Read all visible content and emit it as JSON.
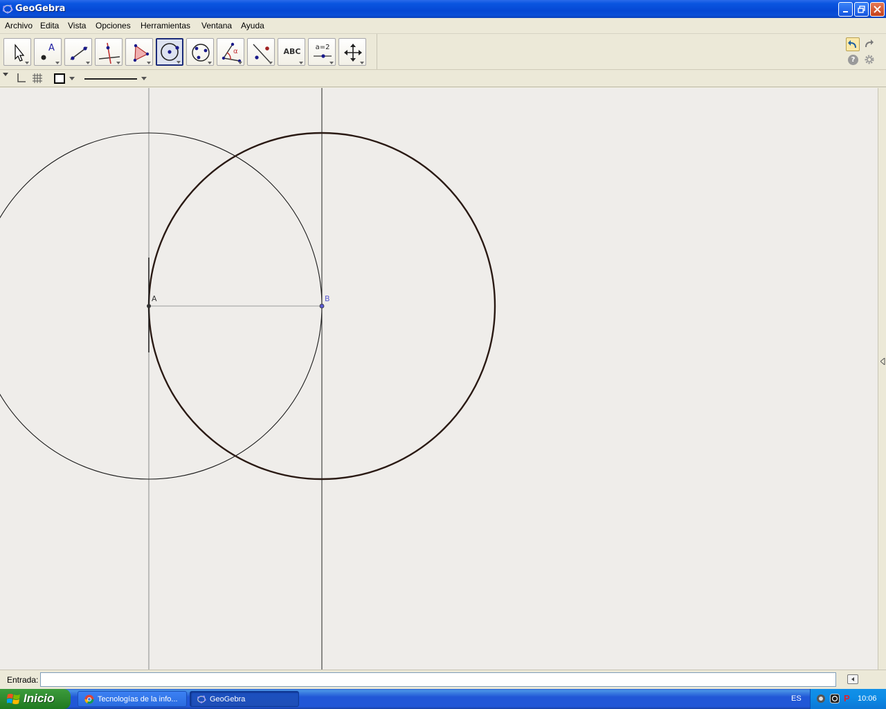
{
  "window": {
    "title": "GeoGebra"
  },
  "menu": [
    "Archivo",
    "Edita",
    "Vista",
    "Opciones",
    "Herramientas",
    "Ventana",
    "Ayuda"
  ],
  "tools": [
    {
      "name": "move",
      "icon": "arrow-cursor-icon"
    },
    {
      "name": "point",
      "icon": "point-icon",
      "label": "A"
    },
    {
      "name": "line",
      "icon": "line-through-two-points-icon"
    },
    {
      "name": "perpendicular",
      "icon": "perpendicular-line-icon"
    },
    {
      "name": "polygon",
      "icon": "polygon-icon"
    },
    {
      "name": "circle-center-point",
      "icon": "circle-center-point-icon",
      "active": true
    },
    {
      "name": "circle-three-points",
      "icon": "circle-through-points-icon"
    },
    {
      "name": "angle",
      "icon": "angle-icon",
      "label": "α"
    },
    {
      "name": "reflect",
      "icon": "reflect-about-line-icon"
    },
    {
      "name": "text",
      "icon": "text-icon",
      "label": "ABC"
    },
    {
      "name": "slider",
      "icon": "slider-icon",
      "label": "a=2"
    },
    {
      "name": "move-graphics",
      "icon": "move-graphics-view-icon"
    }
  ],
  "graphics": {
    "points": [
      {
        "label": "A",
        "color": "#333333"
      },
      {
        "label": "B",
        "color": "#5a5ad0"
      }
    ]
  },
  "input": {
    "label": "Entrada:",
    "value": ""
  },
  "taskbar": {
    "start": "Inicio",
    "tasks": [
      "Tecnologías de la info...",
      "GeoGebra"
    ],
    "lang": "ES",
    "time": "10:06"
  },
  "colors": {
    "titlebar": "#0a55e0",
    "canvas": "#efedea",
    "point_b": "#5a5ad0"
  }
}
